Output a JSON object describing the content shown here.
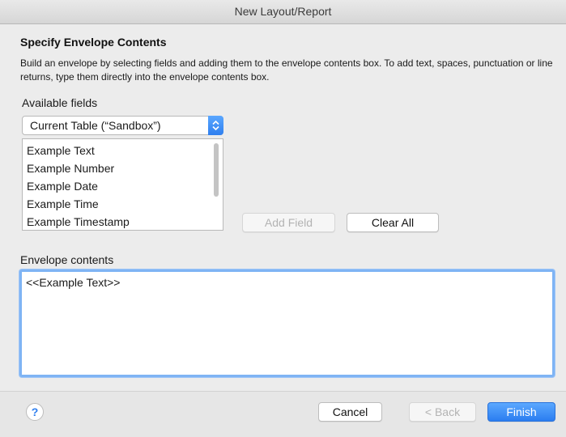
{
  "window": {
    "title": "New Layout/Report"
  },
  "heading": "Specify Envelope Contents",
  "description": "Build an envelope by selecting fields and adding them to the envelope contents box. To add text, spaces, punctuation or line returns, type them directly into the envelope contents box.",
  "available_fields": {
    "label": "Available fields",
    "table_select": "Current Table (“Sandbox”)",
    "items": [
      "Example Text",
      "Example Number",
      "Example Date",
      "Example Time",
      "Example Timestamp"
    ]
  },
  "buttons": {
    "add_field": "Add Field",
    "clear_all": "Clear All",
    "cancel": "Cancel",
    "back": "< Back",
    "finish": "Finish",
    "help": "?"
  },
  "envelope": {
    "label": "Envelope contents",
    "value": "<<Example Text>>"
  },
  "colors": {
    "accent": "#2f7fef"
  }
}
